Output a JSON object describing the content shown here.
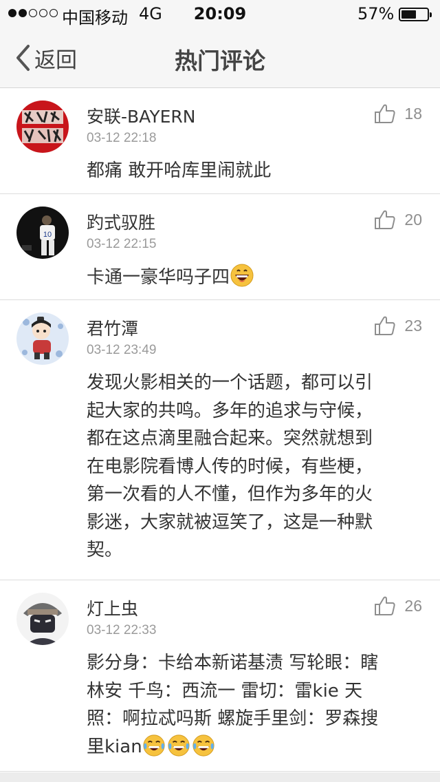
{
  "status_bar": {
    "carrier": "中国移动",
    "network": "4G",
    "time": "20:09",
    "battery_percent": "57%",
    "battery_level": 0.57,
    "signal_strength": 2,
    "signal_max": 5
  },
  "nav": {
    "back_label": "返回",
    "title": "热门评论"
  },
  "comments": [
    {
      "username": "安联-BAYERN",
      "time": "03-12 22:18",
      "likes": "18",
      "text": "都痛 敢开哈库里闹就此",
      "emojis": []
    },
    {
      "username": "趵式驭胜",
      "time": "03-12 22:15",
      "likes": "20",
      "text": "卡通一豪华吗子四",
      "emojis": [
        "grinning-face-emoji"
      ]
    },
    {
      "username": "君竹潭",
      "time": "03-12 23:49",
      "likes": "23",
      "text": "发现火影相关的一个话题，都可以引\n起大家的共鸣。多年的追求与守候，\n都在这点滴里融合起来。突然就想到\n在电影院看博人传的时候，有些梗，\n第一次看的人不懂，但作为多年的火\n影迷，大家就被逗笑了，这是一种默\n契。",
      "emojis": []
    },
    {
      "username": "灯上虫",
      "time": "03-12 22:33",
      "likes": "26",
      "text": "影分身：卡给本新诺基渍 写轮眼：瞎\n林安 千鸟：西流一 雷切：雷kie 天\n照：啊拉忒吗斯 螺旋手里剑：罗森搜\n里kian",
      "emojis": [
        "tears-of-joy-emoji",
        "tears-of-joy-emoji",
        "tears-of-joy-emoji"
      ]
    }
  ],
  "colors": {
    "nav_background": "#f6f6f6",
    "text": "#333333",
    "secondary_text": "#9a9a9a",
    "divider": "#dcdcdc"
  }
}
